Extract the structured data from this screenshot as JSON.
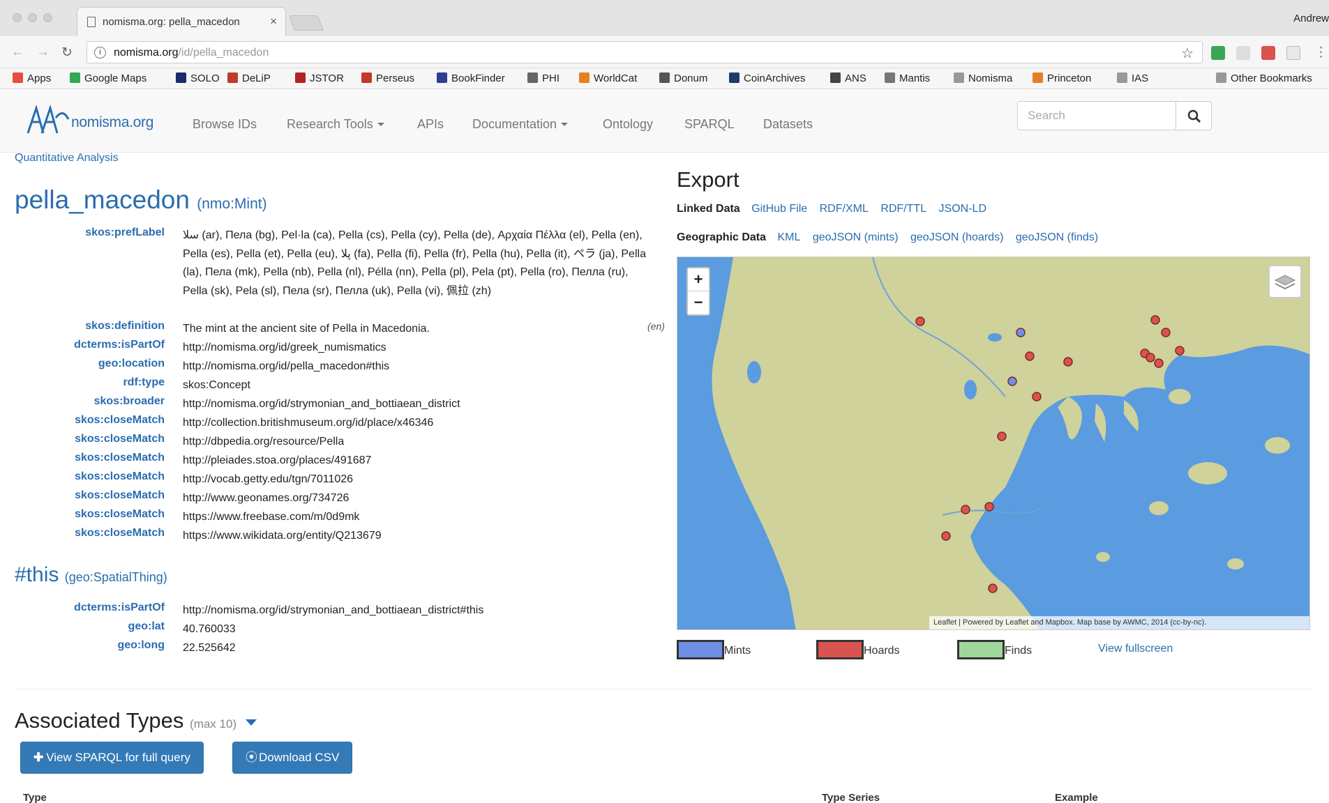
{
  "browser": {
    "tab_title": "nomisma.org: pella_macedon",
    "tab_close": "×",
    "profile_name": "Andrew",
    "url_host": "nomisma.org",
    "url_path": "/id/pella_macedon"
  },
  "bookmarks": [
    {
      "label": "Apps",
      "color": "#e74c3c"
    },
    {
      "label": "Google Maps",
      "color": "#34a853"
    },
    {
      "label": "SOLO",
      "color": "#1b2a6b"
    },
    {
      "label": "DeLiP",
      "color": "#c0392b"
    },
    {
      "label": "JSTOR",
      "color": "#b22222"
    },
    {
      "label": "Perseus",
      "color": "#c0392b"
    },
    {
      "label": "BookFinder",
      "color": "#2c3e90"
    },
    {
      "label": "PHI",
      "color": "#666666"
    },
    {
      "label": "WorldCat",
      "color": "#e67e22"
    },
    {
      "label": "Donum",
      "color": "#555555"
    },
    {
      "label": "CoinArchives",
      "color": "#1f3a6b"
    },
    {
      "label": "ANS",
      "color": "#444444"
    },
    {
      "label": "Mantis",
      "color": "#777777"
    },
    {
      "label": "Nomisma",
      "color": "#999999"
    },
    {
      "label": "Princeton",
      "color": "#e67e22"
    },
    {
      "label": "IAS",
      "color": "#999999"
    },
    {
      "label": "Other Bookmarks",
      "color": "#999999"
    }
  ],
  "site_nav": {
    "logo_text": "nomisma.org",
    "links": [
      "Browse IDs",
      "Research Tools",
      "APIs",
      "Documentation",
      "Ontology",
      "SPARQL",
      "Datasets"
    ],
    "search_placeholder": "Search"
  },
  "quantitative_link": "Quantitative Analysis",
  "title": {
    "id": "pella_macedon",
    "type": "(nmo:Mint)"
  },
  "pref_label": "سلا (ar), Пела (bg), Pel·la (ca), Pella (cs), Pella (cy), Pella (de), Αρχαία Πέλλα (el), Pella (en), Pella (es), Pella (et), Pella (eu), پلا (fa), Pella (fi), Pella (fr), Pella (hu), Pella (it), ペラ (ja), Pella (la), Пела (mk), Pella (nb), Pella (nl), Pélla (nn), Pella (pl), Pela (pt), Pella (ro), Пелла (ru), Pella (sk), Pela (sl), Пела (sr), Пелла (uk), Pella (vi), 佩拉 (zh)",
  "properties": [
    {
      "key": "skos:prefLabel",
      "value": ""
    },
    {
      "key": "skos:definition",
      "value": "The mint at the ancient site of Pella in Macedonia.",
      "lang": "(en)"
    },
    {
      "key": "dcterms:isPartOf",
      "value": "http://nomisma.org/id/greek_numismatics",
      "link": true
    },
    {
      "key": "geo:location",
      "value": "http://nomisma.org/id/pella_macedon#this",
      "link": true
    },
    {
      "key": "rdf:type",
      "value": "skos:Concept",
      "link": true
    },
    {
      "key": "skos:broader",
      "value": "http://nomisma.org/id/strymonian_and_bottiaean_district",
      "link": true
    },
    {
      "key": "skos:closeMatch",
      "value": "http://collection.britishmuseum.org/id/place/x46346",
      "link": true
    },
    {
      "key": "skos:closeMatch",
      "value": "http://dbpedia.org/resource/Pella",
      "link": true
    },
    {
      "key": "skos:closeMatch",
      "value": "http://pleiades.stoa.org/places/491687",
      "link": true
    },
    {
      "key": "skos:closeMatch",
      "value": "http://vocab.getty.edu/tgn/7011026",
      "link": true
    },
    {
      "key": "skos:closeMatch",
      "value": "http://www.geonames.org/734726",
      "link": true
    },
    {
      "key": "skos:closeMatch",
      "value": "https://www.freebase.com/m/0d9mk",
      "link": true
    },
    {
      "key": "skos:closeMatch",
      "value": "https://www.wikidata.org/entity/Q213679",
      "link": true
    }
  ],
  "this_section": {
    "id": "#this",
    "type": "(geo:SpatialThing)",
    "properties": [
      {
        "key": "dcterms:isPartOf",
        "value": "http://nomisma.org/id/strymonian_and_bottiaean_district#this",
        "link": true
      },
      {
        "key": "geo:lat",
        "value": "40.760033",
        "link": false
      },
      {
        "key": "geo:long",
        "value": "22.525642",
        "link": false
      }
    ]
  },
  "export": {
    "title": "Export",
    "linked_label": "Linked Data",
    "linked_links": [
      "GitHub File",
      "RDF/XML",
      "RDF/TTL",
      "JSON-LD"
    ],
    "geo_label": "Geographic Data",
    "geo_links": [
      "KML",
      "geoJSON (mints)",
      "geoJSON (hoards)",
      "geoJSON (finds)"
    ]
  },
  "map": {
    "zoom_in": "+",
    "zoom_out": "−",
    "attribution": "Leaflet | Powered by Leaflet and Mapbox. Map base by AWMC, 2014 (cc-by-nc).",
    "land_color": "#cfd29a",
    "sea_color": "#5b9be0",
    "mint_color": "#6f8fe6",
    "hoard_color": "#d9534f"
  },
  "legend": {
    "mints": "Mints",
    "mints_color": "#6f8fe6",
    "hoards": "Hoards",
    "hoards_color": "#d9534f",
    "finds": "Finds",
    "finds_color": "#9fd89a",
    "fullscreen": "View fullscreen"
  },
  "assoc": {
    "title": "Associated Types",
    "max": "(max 10)",
    "sparql_button": "View SPARQL for full query",
    "csv_button": "Download CSV",
    "col_type": "Type",
    "col_series": "Type Series",
    "col_example": "Example"
  }
}
